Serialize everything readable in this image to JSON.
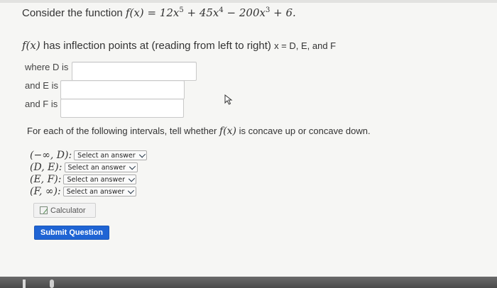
{
  "question": {
    "intro": "Consider the function",
    "function_lhs": "f(x)",
    "function_eq": "=",
    "term1_coef": "12x",
    "term1_exp": "5",
    "term2": "+ 45x",
    "term2_exp": "4",
    "term3": "− 200x",
    "term3_exp": "3",
    "term4": "+ 6.",
    "inflection_fx": "f(x)",
    "inflection_text": "has inflection points at (reading from left to right)",
    "inflection_vars": "x = D, E, and F"
  },
  "answers": [
    {
      "label": "where D is",
      "value": ""
    },
    {
      "label": "and E is",
      "value": ""
    },
    {
      "label": "and F is",
      "value": ""
    }
  ],
  "concavity": {
    "prompt_a": "For each of the following intervals, tell whether",
    "prompt_fx": "f(x)",
    "prompt_b": "is concave up or concave down."
  },
  "intervals": [
    {
      "label": "(−∞, D):",
      "selected": "Select an answer"
    },
    {
      "label": "(D, E):",
      "selected": "Select an answer"
    },
    {
      "label": "(E, F):",
      "selected": "Select an answer"
    },
    {
      "label": "(F, ∞):",
      "selected": "Select an answer"
    }
  ],
  "buttons": {
    "calculator": "Calculator",
    "submit": "Submit Question"
  },
  "colors": {
    "submit_bg": "#1f64d4",
    "page_bg": "#f6f6f4"
  }
}
